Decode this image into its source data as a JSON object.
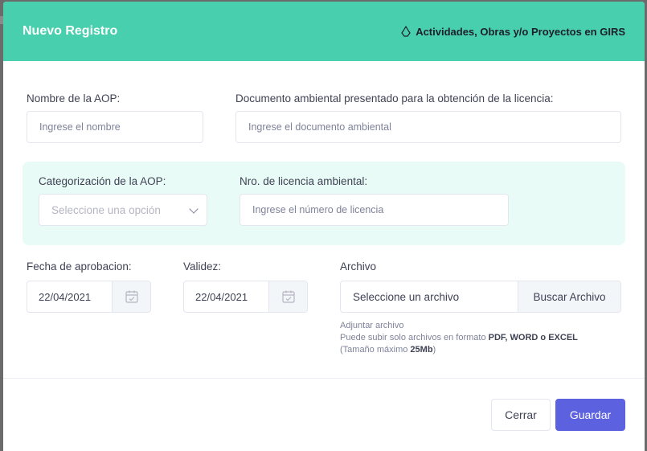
{
  "modal": {
    "title": "Nuevo Registro",
    "subtitle": "Actividades, Obras y/o Proyectos en GIRS"
  },
  "form": {
    "nombre": {
      "label": "Nombre de la AOP:",
      "placeholder": "Ingrese el nombre"
    },
    "documento": {
      "label": "Documento ambiental presentado para la obtención de la licencia:",
      "placeholder": "Ingrese el documento ambiental"
    },
    "categorizacion": {
      "label": "Categorización de la AOP:",
      "selected": "Seleccione una opción"
    },
    "licencia": {
      "label": "Nro. de licencia ambiental:",
      "placeholder": "Ingrese el número de licencia"
    },
    "fecha_aprobacion": {
      "label": "Fecha de aprobacion:",
      "value": "22/04/2021"
    },
    "validez": {
      "label": "Validez:",
      "value": "22/04/2021"
    },
    "archivo": {
      "label": "Archivo",
      "value": "Seleccione un archivo",
      "button": "Buscar Archivo",
      "help_line1": "Adjuntar archivo",
      "help_line2_prefix": "Puede subir solo archivos en formato ",
      "help_line2_formats": "PDF, WORD o EXCEL",
      "help_line3_prefix": "(Tamaño máximo ",
      "help_line3_size": "25Mb",
      "help_line3_suffix": ")"
    }
  },
  "footer": {
    "close_label": "Cerrar",
    "save_label": "Guardar"
  },
  "colors": {
    "header": "#48cfae",
    "band": "#e8fbf6",
    "primary": "#5c61e0"
  },
  "icons": {
    "header": "recycle-icon",
    "date": "calendar-icon",
    "select": "chevron-down-icon"
  }
}
